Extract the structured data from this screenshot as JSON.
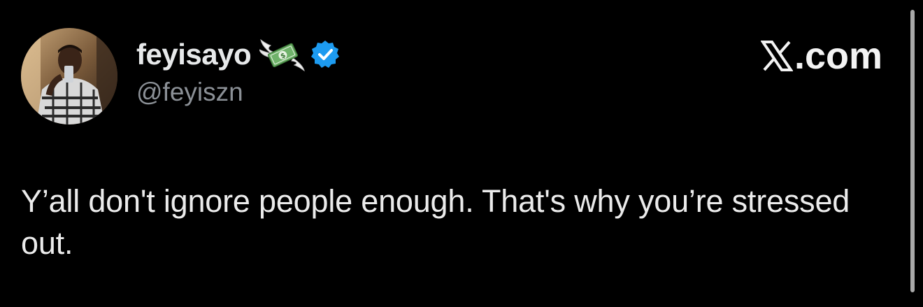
{
  "author": {
    "display_name": "feyisayo",
    "handle": "@feyiszn",
    "name_emoji": "money-with-wings-icon",
    "verified_badge": "verified-badge-icon",
    "verified_color": "#1d9bf0"
  },
  "brand": {
    "label": ".com",
    "logo": "x-logo-icon"
  },
  "tweet": {
    "text": "Y’all don't ignore people enough. That's why you’re stressed out."
  },
  "colors": {
    "background": "#000000",
    "text": "#e7e9ea",
    "secondary_text": "#8b9096"
  }
}
